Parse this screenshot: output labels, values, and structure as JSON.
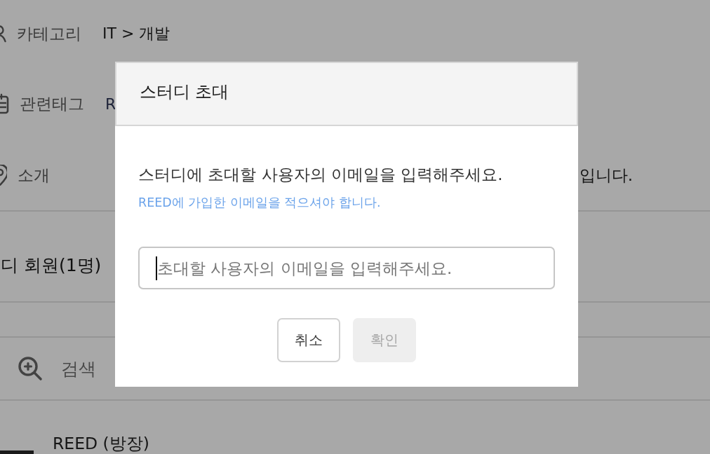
{
  "page": {
    "details": [
      {
        "kind": "category",
        "label": "카테고리",
        "value": "IT > 개발"
      },
      {
        "kind": "tags",
        "label": "관련태그",
        "value": "R"
      },
      {
        "kind": "intro",
        "label": "소개",
        "value_end": "입니다."
      }
    ],
    "members_heading": "디 회원(1명)",
    "search": {
      "label": "검색"
    },
    "members": [
      {
        "name": "REED (방장)"
      }
    ]
  },
  "dialog": {
    "title": "스터디 초대",
    "message": "스터디에 초대할 사용자의 이메일을 입력해주세요.",
    "hint": "REED에 가입한 이메일을 적으셔야 합니다.",
    "email_field": {
      "placeholder": "초대할 사용자의 이메일을 입력해주세요.",
      "focused": true
    },
    "buttons": [
      {
        "label": "취소",
        "disabled": false
      },
      {
        "label": "확인",
        "disabled": true
      }
    ]
  }
}
